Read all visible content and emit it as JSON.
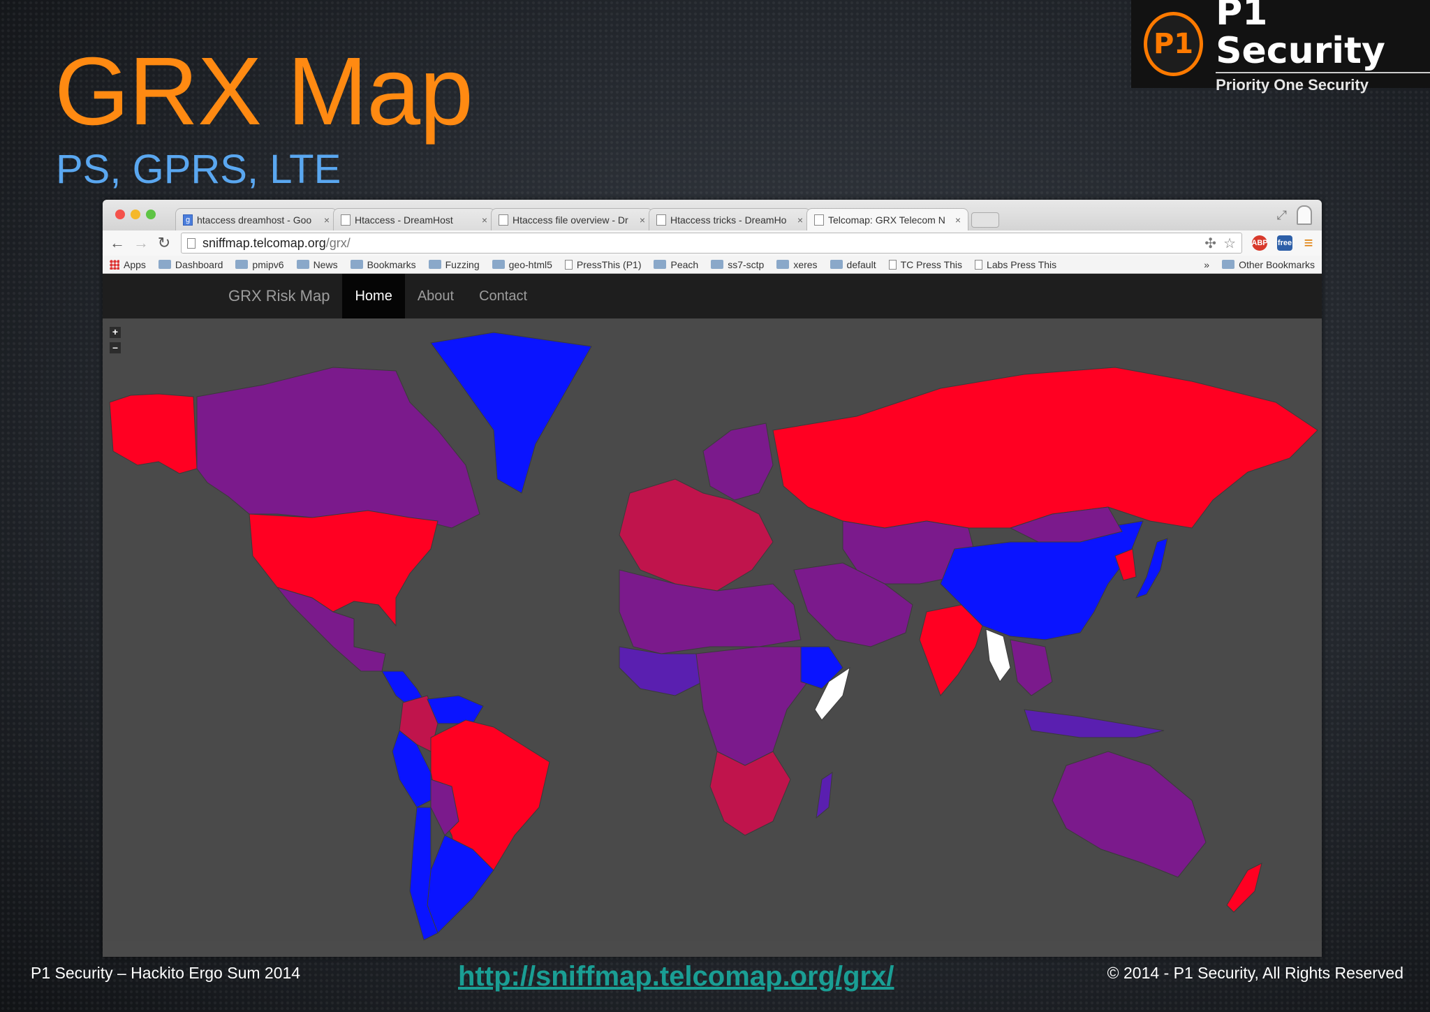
{
  "slide": {
    "title": "GRX Map",
    "subtitle": "PS, GPRS, LTE",
    "footer_left": "P1 Security – Hackito Ergo Sum 2014",
    "footer_link": "http://sniffmap.telcomap.org/grx/",
    "footer_right": "© 2014 - P1 Security, All Rights Reserved"
  },
  "logo": {
    "badge": "P1",
    "name": "P1 Security",
    "tagline": "Priority One Security",
    "accent": "#ff7a00"
  },
  "browser": {
    "tabs": [
      {
        "label": "htaccess dreamhost - Goo",
        "icon": "google-icon",
        "active": false
      },
      {
        "label": "Htaccess - DreamHost",
        "icon": "page-icon",
        "active": false
      },
      {
        "label": "Htaccess file overview - Dr",
        "icon": "page-icon",
        "active": false
      },
      {
        "label": "Htaccess tricks - DreamHo",
        "icon": "page-icon",
        "active": false
      },
      {
        "label": "Telcomap: GRX Telecom N",
        "icon": "page-icon",
        "active": true
      }
    ],
    "close_glyph": "×",
    "url_host": "sniffmap.telcomap.org",
    "url_path": "/grx/",
    "extensions": [
      "ABP",
      "free"
    ],
    "bookmarks": [
      {
        "label": "Apps",
        "icon": "apps-icon"
      },
      {
        "label": "Dashboard",
        "icon": "folder-icon"
      },
      {
        "label": "pmipv6",
        "icon": "folder-icon"
      },
      {
        "label": "News",
        "icon": "folder-icon"
      },
      {
        "label": "Bookmarks",
        "icon": "folder-icon"
      },
      {
        "label": "Fuzzing",
        "icon": "folder-icon"
      },
      {
        "label": "geo-html5",
        "icon": "folder-icon"
      },
      {
        "label": "PressThis (P1)",
        "icon": "page-icon"
      },
      {
        "label": "Peach",
        "icon": "folder-icon"
      },
      {
        "label": "ss7-sctp",
        "icon": "folder-icon"
      },
      {
        "label": "xeres",
        "icon": "folder-icon"
      },
      {
        "label": "default",
        "icon": "folder-icon"
      },
      {
        "label": "TC Press This",
        "icon": "page-icon"
      },
      {
        "label": "Labs Press This",
        "icon": "page-icon"
      }
    ],
    "bookmarks_overflow": "»",
    "other_bookmarks": "Other Bookmarks"
  },
  "site": {
    "brand": "GRX Risk Map",
    "nav": [
      {
        "label": "Home",
        "active": true
      },
      {
        "label": "About",
        "active": false
      },
      {
        "label": "Contact",
        "active": false
      }
    ],
    "zoom_in": "+",
    "zoom_out": "–"
  },
  "map": {
    "ocean_color": "#4a4a4a",
    "risk_colors": {
      "high": "#ff0022",
      "medium_high": "#c0144c",
      "medium": "#7b1a8c",
      "low_medium": "#5a1fb0",
      "low": "#0a14ff",
      "none": "#ffffff"
    },
    "regions": [
      {
        "name": "Alaska",
        "risk": "high"
      },
      {
        "name": "Canada",
        "risk": "medium"
      },
      {
        "name": "Greenland",
        "risk": "low"
      },
      {
        "name": "United States",
        "risk": "high"
      },
      {
        "name": "Mexico",
        "risk": "medium"
      },
      {
        "name": "Central America",
        "risk": "low"
      },
      {
        "name": "Colombia",
        "risk": "medium_high"
      },
      {
        "name": "Venezuela",
        "risk": "low"
      },
      {
        "name": "Brazil",
        "risk": "high"
      },
      {
        "name": "Peru",
        "risk": "low"
      },
      {
        "name": "Bolivia",
        "risk": "medium"
      },
      {
        "name": "Argentina",
        "risk": "low"
      },
      {
        "name": "Chile",
        "risk": "low"
      },
      {
        "name": "Western Europe",
        "risk": "medium_high"
      },
      {
        "name": "Scandinavia",
        "risk": "medium"
      },
      {
        "name": "Russia",
        "risk": "high"
      },
      {
        "name": "Central Asia",
        "risk": "medium"
      },
      {
        "name": "China",
        "risk": "low"
      },
      {
        "name": "Mongolia",
        "risk": "medium"
      },
      {
        "name": "Korea",
        "risk": "high"
      },
      {
        "name": "Japan",
        "risk": "low"
      },
      {
        "name": "India",
        "risk": "high"
      },
      {
        "name": "Myanmar",
        "risk": "none"
      },
      {
        "name": "Southeast Asia",
        "risk": "medium"
      },
      {
        "name": "Indonesia",
        "risk": "low_medium"
      },
      {
        "name": "Middle East",
        "risk": "medium"
      },
      {
        "name": "North Africa",
        "risk": "medium"
      },
      {
        "name": "West Africa",
        "risk": "low_medium"
      },
      {
        "name": "Central Africa",
        "risk": "medium"
      },
      {
        "name": "Ethiopia",
        "risk": "low"
      },
      {
        "name": "Somalia",
        "risk": "none"
      },
      {
        "name": "Southern Africa",
        "risk": "medium_high"
      },
      {
        "name": "Madagascar",
        "risk": "low_medium"
      },
      {
        "name": "Australia",
        "risk": "medium"
      },
      {
        "name": "New Zealand",
        "risk": "high"
      }
    ]
  }
}
